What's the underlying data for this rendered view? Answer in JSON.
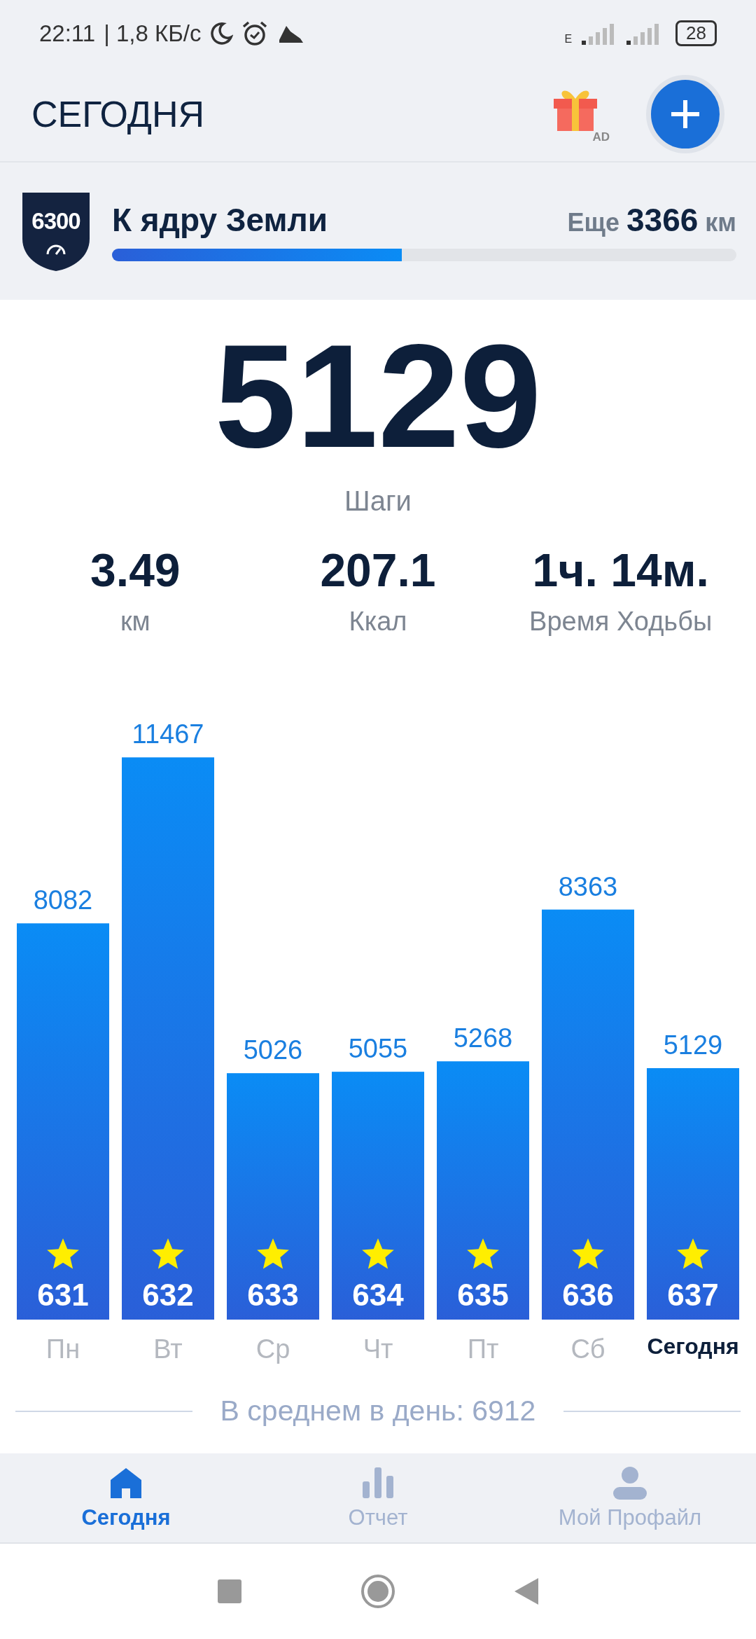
{
  "status_bar": {
    "time": "22:11",
    "speed": "| 1,8 КБ/с",
    "network_label": "E",
    "battery": "28"
  },
  "header": {
    "title": "СЕГОДНЯ",
    "ad_label": "AD"
  },
  "goal": {
    "badge": "6300",
    "title": "К ядру Земли",
    "remaining_prefix": "Еще",
    "remaining_value": "3366",
    "remaining_unit": "км",
    "level": 0.464
  },
  "steps": {
    "value": "5129",
    "label": "Шаги"
  },
  "stats": [
    {
      "value": "3.49",
      "label": "км"
    },
    {
      "value": "207.1",
      "label": "Ккал"
    },
    {
      "value": "1ч. 14м.",
      "label": "Время Ходьбы"
    }
  ],
  "chart": {
    "chart_data": {
      "type": "bar",
      "categories": [
        "Пн",
        "Вт",
        "Ср",
        "Чт",
        "Пт",
        "Сб",
        "Сегодня"
      ],
      "values": [
        8082,
        11467,
        5026,
        5055,
        5268,
        8363,
        5129
      ],
      "data_labels": true
    },
    "bars": [
      {
        "badge": "631",
        "selected": false
      },
      {
        "badge": "632",
        "selected": false
      },
      {
        "badge": "633",
        "selected": false
      },
      {
        "badge": "634",
        "selected": false
      },
      {
        "badge": "635",
        "selected": false
      },
      {
        "badge": "636",
        "selected": false
      },
      {
        "badge": "637",
        "selected": true
      }
    ],
    "average": "В среднем в день: 6912"
  },
  "tabs": [
    {
      "label": "Сегодня",
      "selected": true
    },
    {
      "label": "Отчет",
      "selected": false
    },
    {
      "label": "Мой Профайл",
      "selected": false
    }
  ]
}
